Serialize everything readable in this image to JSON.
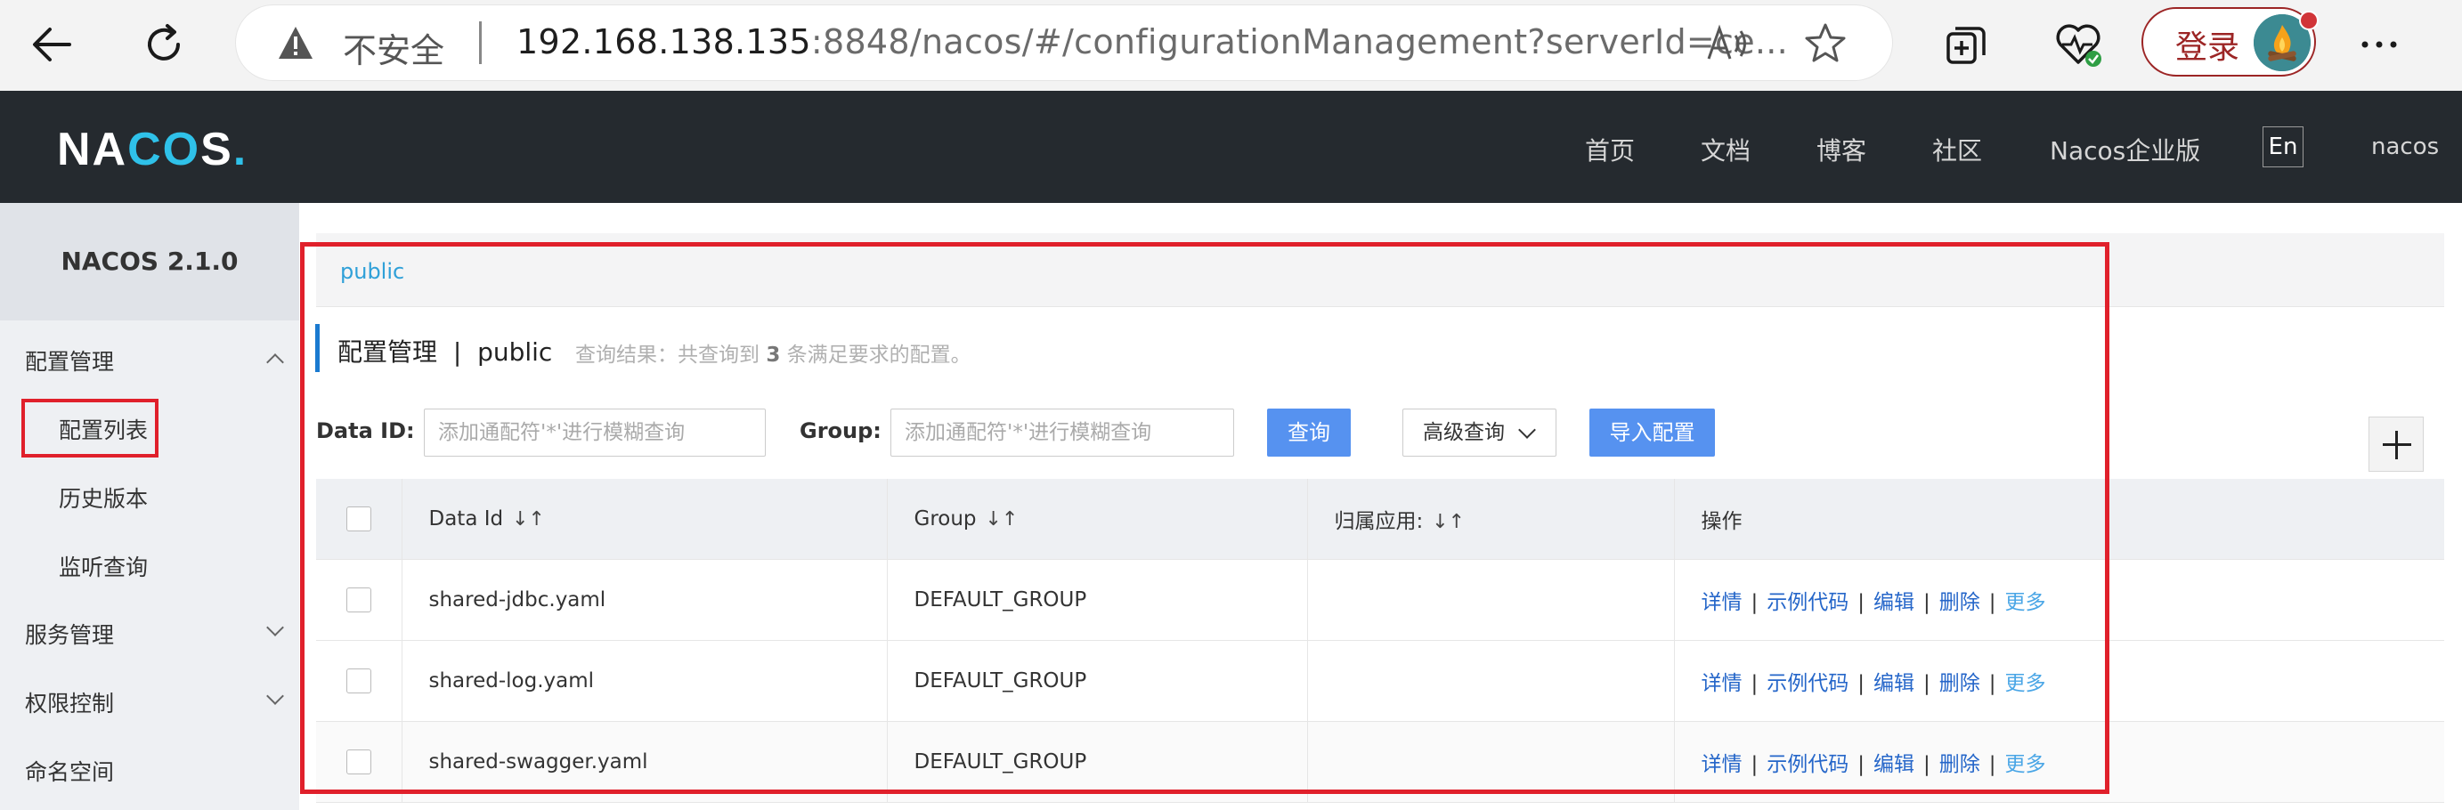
{
  "browser": {
    "insecure_label": "不安全",
    "url_host": "192.168.138.135",
    "url_rest": ":8848/nacos/#/configurationManagement?serverId=ce...",
    "login_label": "登录"
  },
  "header": {
    "logo_left": "NA",
    "logo_mid": "CO",
    "logo_right": "S",
    "logo_dot": ".",
    "nav": [
      "首页",
      "文档",
      "博客",
      "社区",
      "Nacos企业版"
    ],
    "lang": "En",
    "user": "nacos"
  },
  "sidebar": {
    "version": "NACOS 2.1.0",
    "config_mgmt": "配置管理",
    "config_list": "配置列表",
    "history": "历史版本",
    "listen_query": "监听查询",
    "service_mgmt": "服务管理",
    "auth_control": "权限控制",
    "namespace": "命名空间"
  },
  "main": {
    "namespace_tab": "public",
    "title": "配置管理",
    "title_sep": "|",
    "title_ns": "public",
    "result_prefix": "查询结果：共查询到",
    "result_count": "3",
    "result_suffix": "条满足要求的配置。",
    "data_id_label": "Data ID:",
    "data_id_placeholder": "添加通配符'*'进行模糊查询",
    "group_label": "Group:",
    "group_placeholder": "添加通配符'*'进行模糊查询",
    "query_btn": "查询",
    "advanced_btn": "高级查询",
    "import_btn": "导入配置"
  },
  "table": {
    "columns": [
      "Data Id",
      "Group",
      "归属应用:",
      "操作"
    ],
    "sort_glyph": "↓↑",
    "actions": [
      "详情",
      "示例代码",
      "编辑",
      "删除",
      "更多"
    ],
    "action_sep": "|",
    "rows": [
      {
        "data_id": "shared-jdbc.yaml",
        "group": "DEFAULT_GROUP",
        "app": ""
      },
      {
        "data_id": "shared-log.yaml",
        "group": "DEFAULT_GROUP",
        "app": ""
      },
      {
        "data_id": "shared-swagger.yaml",
        "group": "DEFAULT_GROUP",
        "app": ""
      }
    ]
  },
  "icons": {
    "back": "arrow-left-icon",
    "reload": "reload-icon",
    "warning": "warning-triangle-icon",
    "read_aloud": "read-aloud-icon",
    "favorite": "star-icon",
    "collections": "collections-icon",
    "health": "browser-essentials-icon",
    "more": "more-dots-icon",
    "add": "plus-icon"
  },
  "colors": {
    "header_bg": "#252a2f",
    "accent_blue": "#5692f0",
    "link_blue": "#2566c9",
    "highlight_red": "#e0202b"
  }
}
